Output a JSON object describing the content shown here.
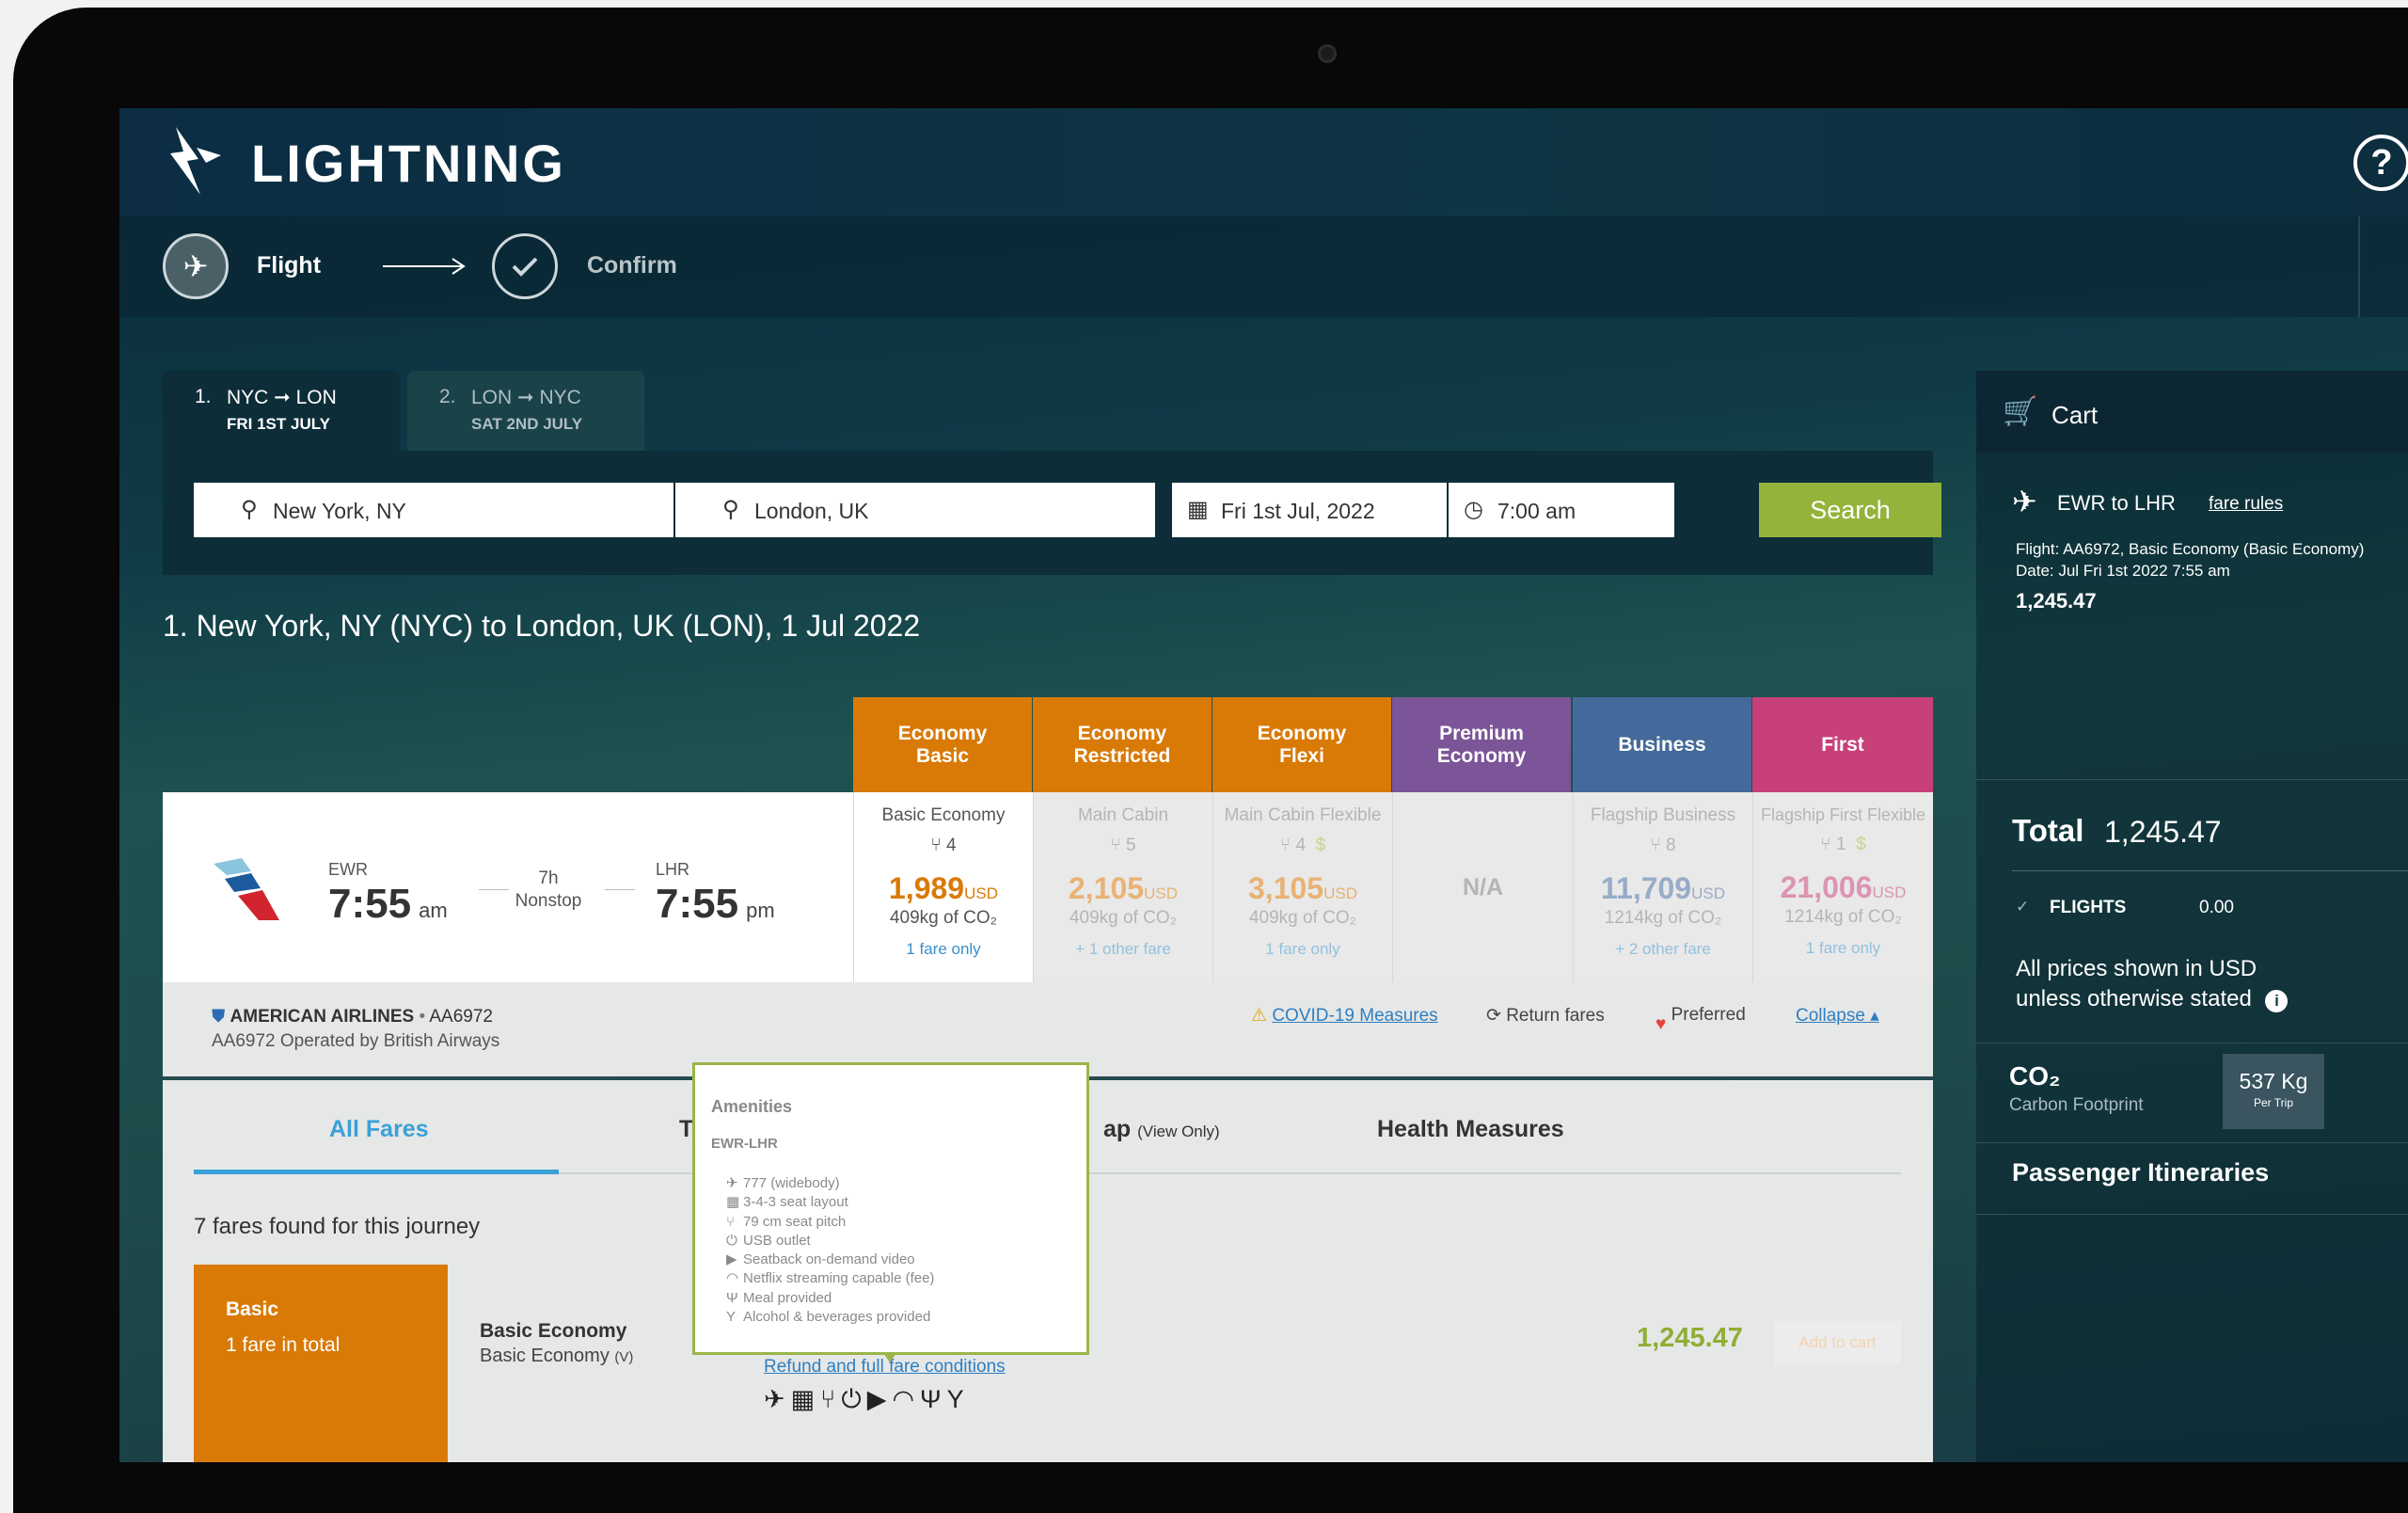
{
  "brand": {
    "name": "LIGHTNING"
  },
  "steps": [
    {
      "label": "Flight",
      "icon": "plane-icon"
    },
    {
      "label": "Confirm",
      "icon": "check-icon"
    }
  ],
  "legs": [
    {
      "num": "1.",
      "route": "NYC ➞ LON",
      "date": "FRI 1ST JULY"
    },
    {
      "num": "2.",
      "route": "LON ➞ NYC",
      "date": "SAT 2ND JULY"
    }
  ],
  "search": {
    "from": "New York, NY",
    "to": "London, UK",
    "date": "Fri 1st Jul, 2022",
    "time": "7:00 am",
    "button": "Search"
  },
  "journey_title": "1. New York, NY (NYC) to London, UK (LON), 1 Jul 2022",
  "fare_classes": [
    {
      "line1": "Economy",
      "line2": "Basic",
      "color": "#d97a07"
    },
    {
      "line1": "Economy",
      "line2": "Restricted",
      "color": "#d97a07"
    },
    {
      "line1": "Economy",
      "line2": "Flexi",
      "color": "#d97a07"
    },
    {
      "line1": "Premium",
      "line2": "Economy",
      "color": "#7b5597"
    },
    {
      "line1": "Business",
      "line2": "",
      "color": "#436a9a"
    },
    {
      "line1": "First",
      "line2": "",
      "color": "#c8407a"
    }
  ],
  "flight": {
    "dep_code": "EWR",
    "dep_time": "7:55",
    "dep_ampm": "am",
    "duration": "7h",
    "stops": "Nonstop",
    "arr_code": "LHR",
    "arr_time": "7:55",
    "arr_ampm": "pm"
  },
  "fares": [
    {
      "name": "Basic Economy",
      "seats": "4",
      "price": "1,989",
      "currency": "USD",
      "co2": "409kg of CO₂",
      "link": "1 fare only",
      "dollar": ""
    },
    {
      "name": "Main Cabin",
      "seats": "5",
      "price": "2,105",
      "currency": "USD",
      "co2": "409kg of CO₂",
      "link": "+ 1 other fare",
      "dollar": ""
    },
    {
      "name": "Main Cabin Flexible",
      "seats": "4",
      "price": "3,105",
      "currency": "USD",
      "co2": "409kg of CO₂",
      "link": "1 fare only",
      "dollar": "$"
    },
    {
      "na": "N/A"
    },
    {
      "name": "Flagship Business",
      "seats": "8",
      "price": "11,709",
      "currency": "USD",
      "co2": "1214kg of CO₂",
      "link": "+ 2 other fare",
      "dollar": ""
    },
    {
      "name": "Flagship First Flexible",
      "seats": "1",
      "price": "21,006",
      "currency": "USD",
      "co2": "1214kg of CO₂",
      "link": "1 fare only",
      "dollar": "$"
    }
  ],
  "airline": {
    "name": "AMERICAN AIRLINES",
    "flight_no": "AA6972",
    "operated": "AA6972 Operated by British Airways",
    "covid": "COVID-19 Measures",
    "return": "Return fares",
    "preferred": "Preferred",
    "collapse": "Collapse ▴"
  },
  "lower_tabs": [
    {
      "label": "All Fares"
    },
    {
      "label": "T"
    },
    {
      "label": "ap",
      "sub": "(View Only)"
    },
    {
      "label": "Health Measures"
    }
  ],
  "fares_found": "7 fares found for this journey",
  "fare_row": {
    "box_title": "Basic",
    "box_sub": "1 fare in total",
    "name": "Basic Economy",
    "sub": "Basic Economy",
    "sub_code": "(V)",
    "refund": "Refund and full fare conditions",
    "price": "1,245.47",
    "add": "Add to cart"
  },
  "amenities": {
    "title": "Amenities",
    "route": "EWR-LHR",
    "items": [
      {
        "icon": "✈",
        "text": "777 (widebody)"
      },
      {
        "icon": "▦",
        "text": "3-4-3 seat layout"
      },
      {
        "icon": "⑂",
        "text": "79 cm seat pitch"
      },
      {
        "icon": "⏻",
        "text": "USB outlet"
      },
      {
        "icon": "▶",
        "text": "Seatback on-demand video"
      },
      {
        "icon": "◠",
        "text": "Netflix streaming capable (fee)"
      },
      {
        "icon": "Ψ",
        "text": "Meal provided"
      },
      {
        "icon": "Y",
        "text": "Alcohol & beverages provided"
      }
    ]
  },
  "cart": {
    "title": "Cart",
    "route": "EWR to LHR",
    "fare_rules": "fare rules",
    "flight_line": "Flight: AA6972, Basic Economy (Basic Economy)",
    "date_line": "Date: Jul Fri 1st 2022 7:55 am",
    "amount": "1,245.47",
    "total_label": "Total",
    "total": "1,245.47",
    "flights_label": "FLIGHTS",
    "flights_value": "0.00",
    "note": "All prices shown in USD unless otherwise stated",
    "co2_label": "CO₂",
    "co2_sub": "Carbon Footprint",
    "co2_value": "537 Kg",
    "co2_per": "Per Trip",
    "itineraries": "Passenger Itineraries"
  }
}
